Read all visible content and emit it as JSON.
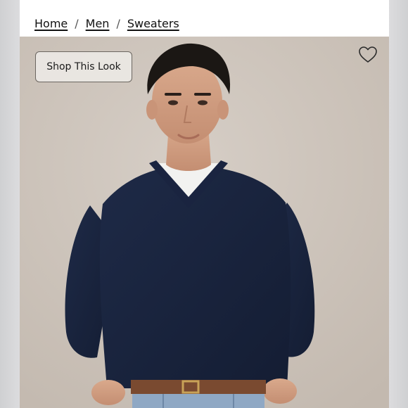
{
  "breadcrumb": {
    "items": [
      "Home",
      "Men",
      "Sweaters"
    ],
    "separator": "/"
  },
  "hero": {
    "shop_button_label": "Shop This Look",
    "favorite_icon": "heart-outline-icon",
    "background_color": "#c9c0b7",
    "sweater_color": "#1a2540"
  }
}
